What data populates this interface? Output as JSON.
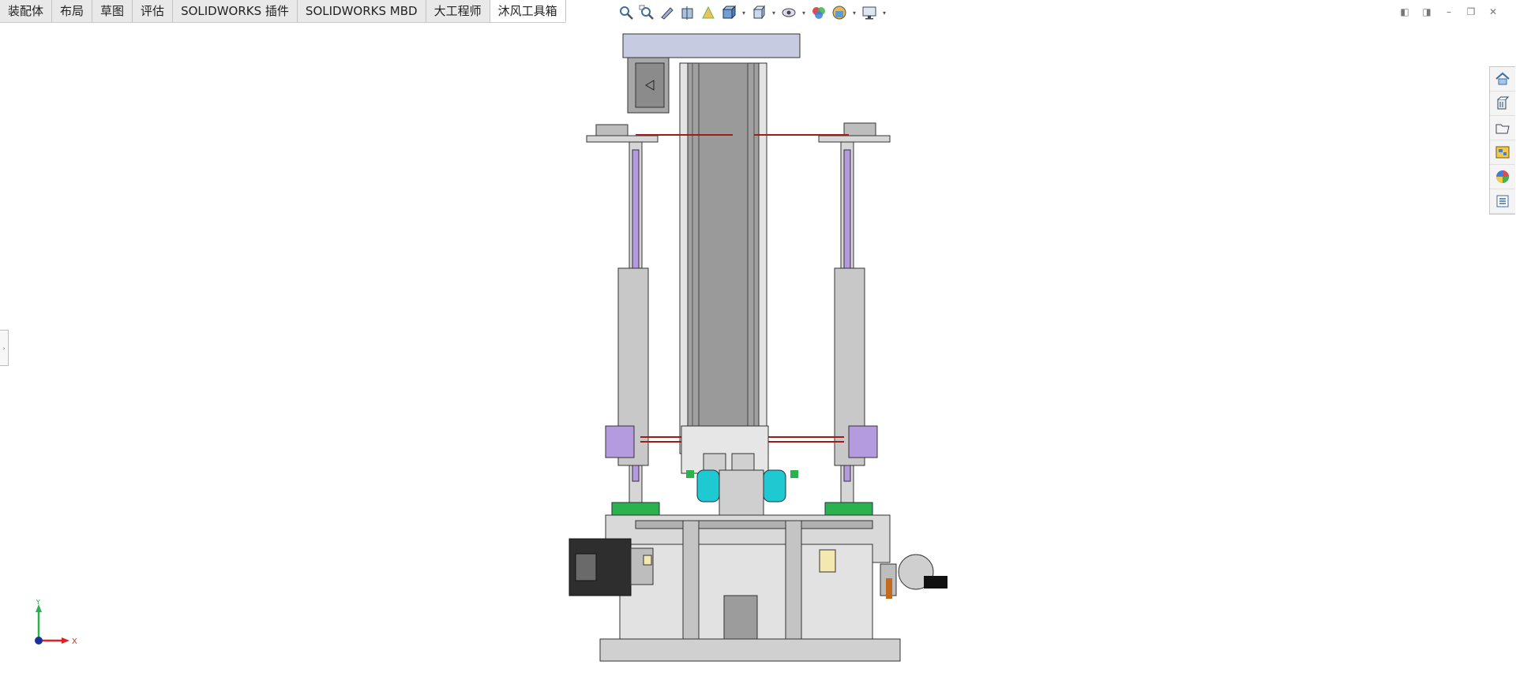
{
  "tabs": [
    {
      "label": "装配体",
      "active": false
    },
    {
      "label": "布局",
      "active": false
    },
    {
      "label": "草图",
      "active": false
    },
    {
      "label": "评估",
      "active": false
    },
    {
      "label": "SOLIDWORKS 插件",
      "active": false
    },
    {
      "label": "SOLIDWORKS MBD",
      "active": false
    },
    {
      "label": "大工程师",
      "active": false
    },
    {
      "label": "沐风工具箱",
      "active": true
    }
  ],
  "triad": {
    "x_label": "X",
    "y_label": "Y"
  },
  "colors": {
    "accent_teal": "#1fc9d2",
    "accent_purple": "#b49be0",
    "accent_green": "#2bb24c",
    "frame_gray": "#b8b8b8"
  },
  "icons": {
    "hud": [
      "zoom-to-fit-icon",
      "zoom-to-area-icon",
      "previous-view-icon",
      "section-view-icon",
      "dynamic-annotation-icon",
      "view-orientation-icon",
      "display-style-icon",
      "hide-show-icon",
      "edit-appearance-icon",
      "apply-scene-icon",
      "view-settings-icon"
    ],
    "taskpane": [
      "home-icon",
      "design-library-icon",
      "file-explorer-icon",
      "view-palette-icon",
      "appearances-icon",
      "custom-properties-icon"
    ]
  }
}
